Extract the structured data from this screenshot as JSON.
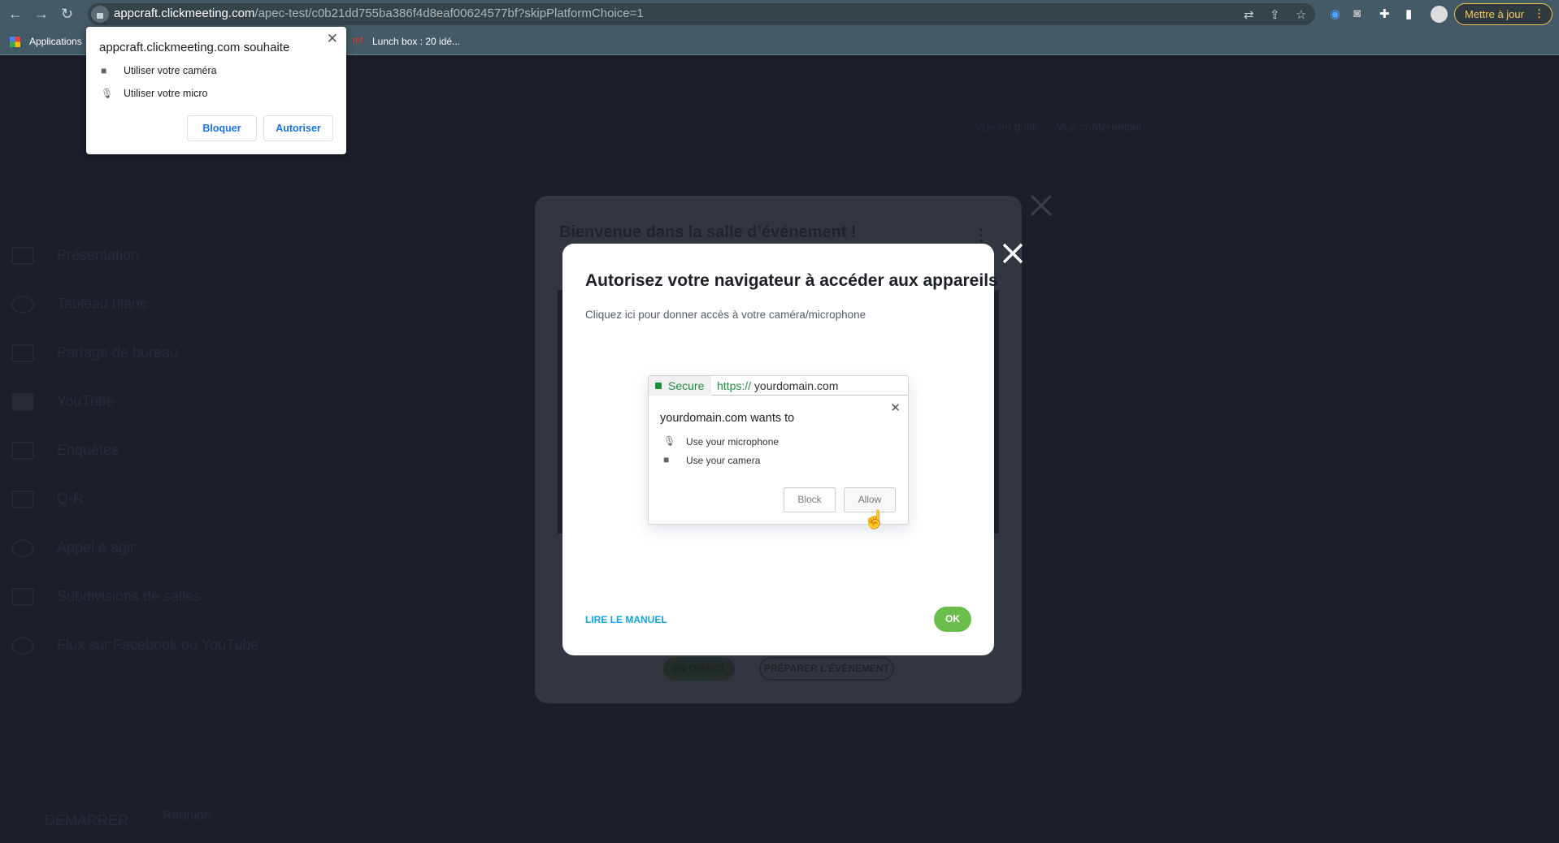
{
  "browser": {
    "url_host": "appcraft.clickmeeting.com",
    "url_path": "/apec-test/c0b21dd755ba386f4d8eaf00624577bf?skipPlatformChoice=1",
    "update_button": "Mettre à jour",
    "bookmarks": [
      {
        "label": "Applications"
      },
      {
        "label": "Lunch box : 20 idé...",
        "prefix": "mf"
      }
    ]
  },
  "permission_popup": {
    "title": "appcraft.clickmeeting.com souhaite",
    "items": [
      {
        "icon": "camera-icon",
        "label": "Utiliser votre caméra"
      },
      {
        "icon": "microphone-icon",
        "label": "Utiliser votre micro"
      }
    ],
    "block_label": "Bloquer",
    "allow_label": "Autoriser"
  },
  "background": {
    "sidebar": [
      "Présentation",
      "Tableau blanc",
      "Partage de bureau",
      "YouTube",
      "Enquêtes",
      "Q-R",
      "Appel à agir",
      "Subdivisions de salles",
      "Flux sur Facebook ou YouTube"
    ],
    "bottom_start": "DÉMARRER",
    "bottom_meeting": "Réunion",
    "view_grid": "Vue en grille",
    "view_speaker": "Vue conférencier"
  },
  "event_modal": {
    "title": "Bienvenue dans la salle d’événement !",
    "live_label": "EN DIRECT",
    "prepare_label": "PRÉPARER L'ÉVÉNEMENT"
  },
  "device_modal": {
    "title": "Autorisez votre navigateur à accéder aux appareils",
    "subtitle": "Cliquez ici pour donner accès à votre caméra/microphone",
    "illustration": {
      "secure": "Secure",
      "scheme": "https://",
      "domain": "yourdomain.com",
      "heading": "yourdomain.com wants to",
      "mic": "Use your microphone",
      "camera": "Use your camera",
      "block": "Block",
      "allow": "Allow"
    },
    "manual_link": "LIRE LE MANUEL",
    "ok_label": "OK",
    "colors": {
      "ok": "#6bbe4b",
      "link": "#11a5e0"
    }
  }
}
